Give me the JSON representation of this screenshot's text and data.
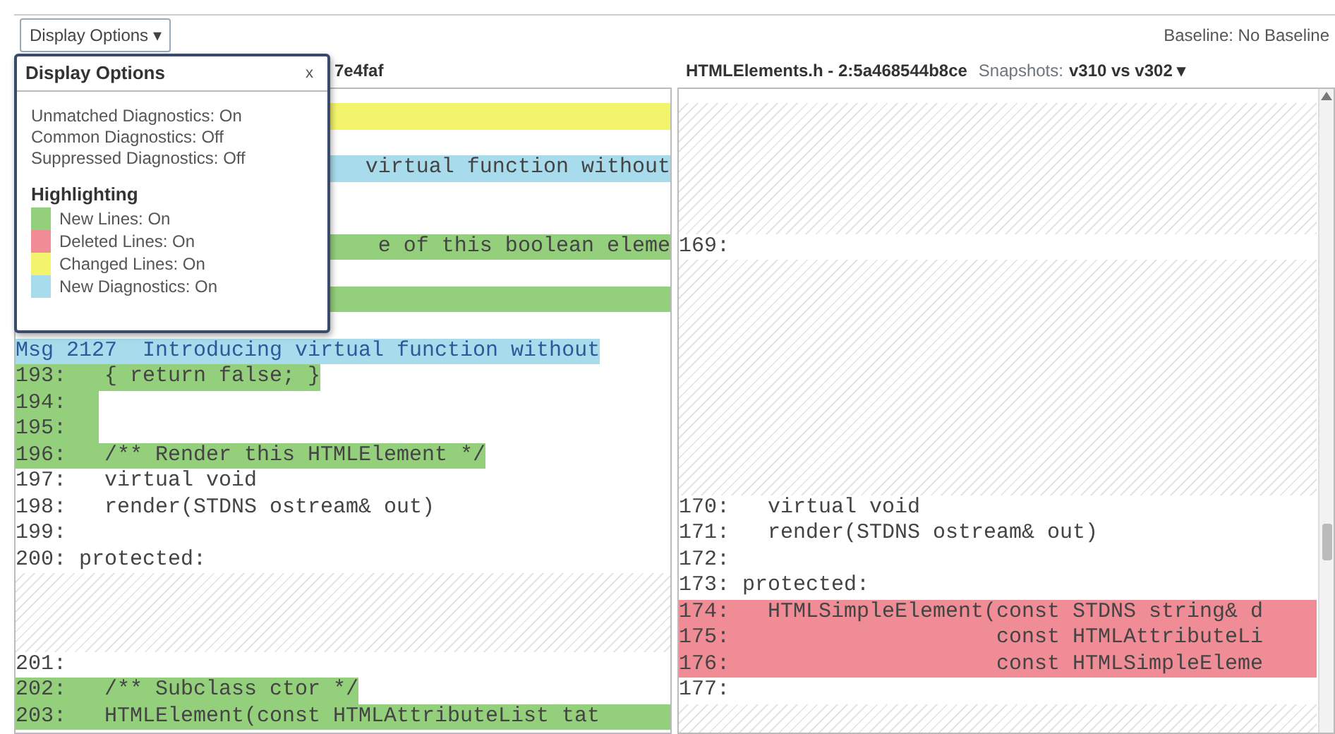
{
  "toolbar": {
    "display_button": {
      "label": "Display Options",
      "caret": "▾"
    },
    "baseline": "Baseline: No Baseline"
  },
  "left_pane": {
    "title": "7e4faf",
    "rows": [
      {
        "kind": "covered",
        "color": "#f4f46c"
      },
      {
        "kind": "covered"
      },
      {
        "kind": "covered",
        "color": "#a8dcec",
        "code": "virtual function without"
      },
      {
        "kind": "covered"
      },
      {
        "kind": "covered"
      },
      {
        "kind": "covered",
        "color": "#94d07c",
        "code": "e of this boolean eleme"
      },
      {
        "kind": "covered"
      },
      {
        "kind": "covered",
        "color": "#94d07c"
      },
      {
        "kind": "covered"
      },
      {
        "kind": "msg",
        "color": "#a8dcec",
        "code": "Msg 2127  Introducing virtual function without"
      },
      {
        "kind": "line",
        "number": "193:",
        "code": "  { return false; }",
        "color": "#94d07c",
        "full_width": false
      },
      {
        "kind": "line",
        "number": "194:",
        "color": "#94d07c",
        "full_width": false
      },
      {
        "kind": "line",
        "number": "195:",
        "color": "#94d07c",
        "full_width": false
      },
      {
        "kind": "line",
        "number": "196:",
        "code": "  /** Render this HTMLElement */",
        "color": "#94d07c",
        "full_width": false
      },
      {
        "kind": "line",
        "number": "197:",
        "code": "  virtual void"
      },
      {
        "kind": "line",
        "number": "198:",
        "code": "  render(STDNS ostream& out)"
      },
      {
        "kind": "line",
        "number": "199:"
      },
      {
        "kind": "line",
        "number": "200:",
        "code": "protected:"
      },
      {
        "kind": "hatch"
      },
      {
        "kind": "hatch"
      },
      {
        "kind": "hatch"
      },
      {
        "kind": "line",
        "number": "201:"
      },
      {
        "kind": "line",
        "number": "202:",
        "code": "  /** Subclass ctor */",
        "color": "#94d07c",
        "full_width": false
      },
      {
        "kind": "line",
        "number": "203:",
        "code": "  HTMLElement(const HTMLAttributeList tat",
        "color": "#94d07c",
        "full_width": true
      }
    ]
  },
  "right_pane": {
    "title": "HTMLElements.h - 2:5a468544b8ce",
    "snapshots_label": "Snapshots:",
    "snapshots_value": "v310 vs v302",
    "snapshots_caret": "▾",
    "rows": [
      {
        "kind": "hatch"
      },
      {
        "kind": "hatch"
      },
      {
        "kind": "hatch"
      },
      {
        "kind": "hatch"
      },
      {
        "kind": "hatch"
      },
      {
        "kind": "line",
        "number": "169:"
      },
      {
        "kind": "hatch"
      },
      {
        "kind": "hatch"
      },
      {
        "kind": "hatch"
      },
      {
        "kind": "hatch"
      },
      {
        "kind": "hatch"
      },
      {
        "kind": "hatch"
      },
      {
        "kind": "hatch"
      },
      {
        "kind": "hatch"
      },
      {
        "kind": "hatch"
      },
      {
        "kind": "line",
        "number": "170:",
        "code": "  virtual void"
      },
      {
        "kind": "line",
        "number": "171:",
        "code": "  render(STDNS ostream& out)"
      },
      {
        "kind": "line",
        "number": "172:"
      },
      {
        "kind": "line",
        "number": "173:",
        "code": "protected:"
      },
      {
        "kind": "line",
        "number": "174:",
        "code": "  HTMLSimpleElement(const STDNS string& d",
        "color": "#f08c96",
        "full_width": true
      },
      {
        "kind": "line",
        "number": "175:",
        "code": "                    const HTMLAttributeLi",
        "color": "#f08c96",
        "full_width": true
      },
      {
        "kind": "line",
        "number": "176:",
        "code": "                    const HTMLSimpleEleme",
        "color": "#f08c96",
        "full_width": true
      },
      {
        "kind": "line",
        "number": "177:"
      },
      {
        "kind": "hatch"
      },
      {
        "kind": "hatch"
      }
    ]
  },
  "display_options_popup": {
    "title": "Display Options",
    "close": "x",
    "options": [
      "Unmatched Diagnostics: On",
      "Common Diagnostics: Off",
      "Suppressed Diagnostics: Off"
    ],
    "highlighting_heading": "Highlighting",
    "legend": [
      {
        "label": "New Lines: On",
        "color": "#94d07c"
      },
      {
        "label": "Deleted Lines: On",
        "color": "#f08c96"
      },
      {
        "label": "Changed Lines: On",
        "color": "#f4f46c"
      },
      {
        "label": "New Diagnostics: On",
        "color": "#a8dcec"
      }
    ]
  }
}
